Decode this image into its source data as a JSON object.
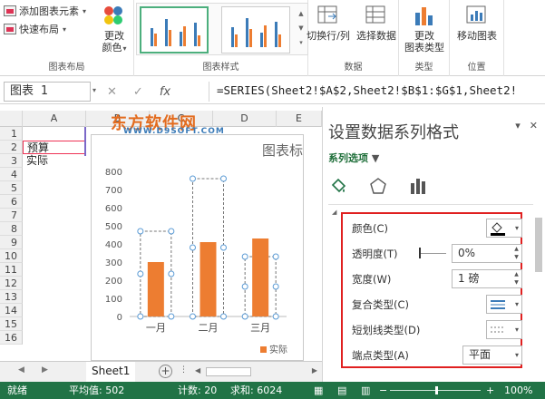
{
  "ribbon": {
    "add_chart_element": "添加图表元素",
    "quick_layout": "快速布局",
    "change_colors_line1": "更改",
    "change_colors_line2": "颜色",
    "group_chart_layouts": "图表布局",
    "group_chart_styles": "图表样式",
    "switch_row_col": "切换行/列",
    "select_data": "选择数据",
    "group_data": "数据",
    "change_chart_type_line1": "更改",
    "change_chart_type_line2": "图表类型",
    "group_type": "类型",
    "move_chart": "移动图表",
    "group_location": "位置"
  },
  "formula_bar": {
    "name_box": "图表 1",
    "cancel": "✕",
    "enter": "✓",
    "fx": "fx",
    "formula": "=SERIES(Sheet2!$A$2,Sheet2!$B$1:$G$1,Sheet2!"
  },
  "sheet": {
    "col_headers": [
      "A",
      "B",
      "C",
      "D",
      "E"
    ],
    "row_headers": [
      "1",
      "2",
      "3",
      "4",
      "5",
      "6",
      "7",
      "8",
      "9",
      "10",
      "11",
      "12",
      "13",
      "14",
      "15",
      "16"
    ],
    "cell_a2": "预算",
    "cell_a3": "实际"
  },
  "watermark": {
    "main": "东方软件网",
    "sub": "WWW.D9SOFT.COM"
  },
  "chart_data": {
    "type": "bar",
    "title": "图表标",
    "categories": [
      "一月",
      "二月",
      "三月"
    ],
    "series": [
      {
        "name": "预算",
        "values": [
          470,
          760,
          330
        ],
        "style": "dashed-outline"
      },
      {
        "name": "实际",
        "values": [
          300,
          410,
          430
        ],
        "color": "#ed7d31"
      }
    ],
    "ylim": [
      0,
      800
    ],
    "yticks": [
      "0",
      "100",
      "200",
      "300",
      "400",
      "500",
      "600",
      "700",
      "800"
    ],
    "legend": "实际",
    "legend_position": "bottom-right"
  },
  "pane": {
    "title": "设置数据系列格式",
    "series_options": "系列选项",
    "close": "✕",
    "props": {
      "color_label": "颜色(C)",
      "transparency_label": "透明度(T)",
      "transparency_value": "0%",
      "width_label": "宽度(W)",
      "width_value": "1 磅",
      "compound_label": "复合类型(C)",
      "dash_label": "短划线类型(D)",
      "cap_label": "端点类型(A)",
      "cap_value": "平面"
    }
  },
  "tabs": {
    "sheet1": "Sheet1"
  },
  "status": {
    "ready": "就绪",
    "average": "平均值: 502",
    "count": "计数: 20",
    "sum": "求和: 6024",
    "zoom": "100%"
  },
  "colors": {
    "accent_green": "#217346",
    "bar_orange": "#ed7d31",
    "highlight_red": "#e02020"
  }
}
